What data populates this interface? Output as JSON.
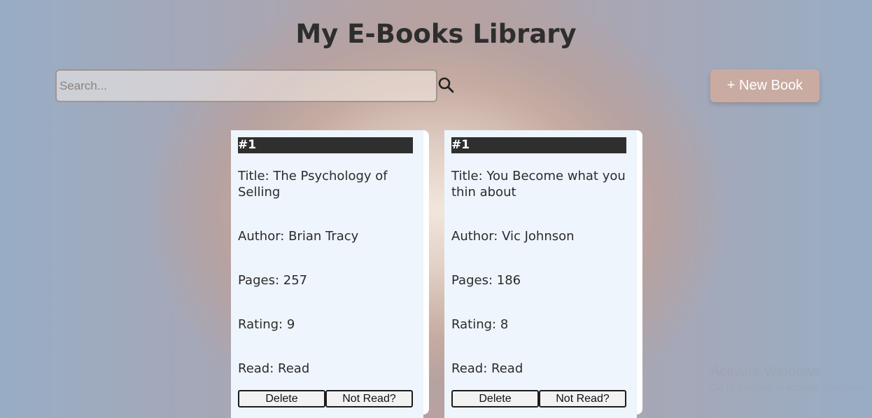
{
  "header": {
    "title": "My E-Books Library"
  },
  "toolbar": {
    "search_placeholder": "Search...",
    "search_icon": "search-icon",
    "new_book_label": "+ New Book"
  },
  "books": [
    {
      "number": "#1",
      "title": "Title: The Psychology of Selling",
      "author": "Author: Brian Tracy",
      "pages": "Pages: 257",
      "rating": "Rating: 9",
      "read": "Read: Read",
      "delete_label": "Delete",
      "toggle_label": "Not Read?"
    },
    {
      "number": "#1",
      "title": "Title: You Become what you thin about",
      "author": "Author: Vic Johnson",
      "pages": "Pages: 186",
      "rating": "Rating: 8",
      "read": "Read: Read",
      "delete_label": "Delete",
      "toggle_label": "Not Read?"
    }
  ],
  "overlay": {
    "activate_title": "Activate Windows",
    "activate_sub": "Go to Settings to activate Windows."
  },
  "colors": {
    "accent_button": "#c9aba2",
    "card_background": "#eef5fc",
    "number_bar": "#2f2f2f"
  }
}
